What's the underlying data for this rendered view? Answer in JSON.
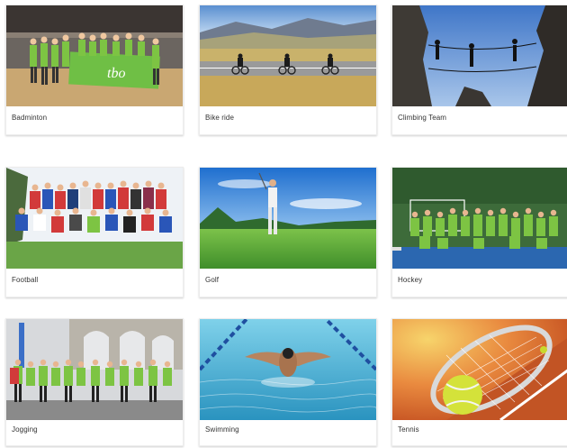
{
  "cards": [
    {
      "id": "badminton",
      "label": "Badminton",
      "banner_text": "tbo",
      "icon": "badminton-team-photo"
    },
    {
      "id": "bike",
      "label": "Bike ride",
      "icon": "bike-ride-photo"
    },
    {
      "id": "climbing",
      "label": "Climbing Team",
      "icon": "climbing-photo"
    },
    {
      "id": "football",
      "label": "Football",
      "icon": "football-team-photo"
    },
    {
      "id": "golf",
      "label": "Golf",
      "icon": "golf-photo"
    },
    {
      "id": "hockey",
      "label": "Hockey",
      "icon": "hockey-team-photo"
    },
    {
      "id": "jogging",
      "label": "Jogging",
      "icon": "jogging-photo"
    },
    {
      "id": "swimming",
      "label": "Swimming",
      "icon": "swimming-photo"
    },
    {
      "id": "tennis",
      "label": "Tennis",
      "icon": "tennis-photo"
    }
  ],
  "colors": {
    "label_text": "#333333",
    "team_green": "#7dc443",
    "sky_blue": "#2d86d9",
    "pool_blue": "#3fa3c9"
  }
}
